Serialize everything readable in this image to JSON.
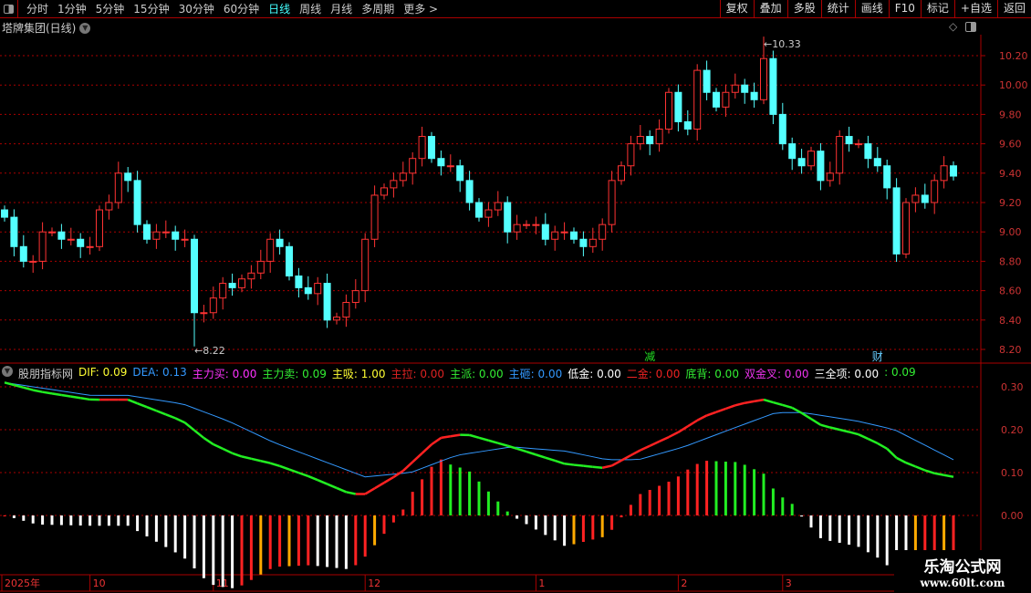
{
  "toolbar": {
    "periods": [
      "分时",
      "1分钟",
      "5分钟",
      "15分钟",
      "30分钟",
      "60分钟",
      "日线",
      "周线",
      "月线",
      "多周期",
      "更多 >"
    ],
    "active_period": "日线",
    "right_buttons": [
      "复权",
      "叠加",
      "多股",
      "统计",
      "画线",
      "F10",
      "标记",
      "+自选",
      "返回"
    ]
  },
  "main": {
    "title": "塔牌集团(日线)",
    "high_label": "10.33",
    "low_label": "8.22",
    "markers": [
      {
        "text": "减",
        "index": 68,
        "color": "#22dd22"
      },
      {
        "text": "财",
        "index": 92,
        "color": "#66ccff"
      }
    ],
    "yticks": [
      "10.20",
      "10.00",
      "9.80",
      "9.60",
      "9.40",
      "9.20",
      "9.00",
      "8.80",
      "8.60",
      "8.40",
      "8.20"
    ]
  },
  "indicator": {
    "name": "股朋指标网",
    "items": [
      {
        "label": "DIF",
        "value": "0.09",
        "color": "#ffff33"
      },
      {
        "label": "DEA",
        "value": "0.13",
        "color": "#3399ff"
      },
      {
        "label": "主力买",
        "value": "0.00",
        "color": "#ff33ff"
      },
      {
        "label": "主力卖",
        "value": "0.09",
        "color": "#33ee33"
      },
      {
        "label": "主吸",
        "value": "1.00",
        "color": "#ffff33"
      },
      {
        "label": "主拉",
        "value": "0.00",
        "color": "#dd2222"
      },
      {
        "label": "主派",
        "value": "0.00",
        "color": "#33ee33"
      },
      {
        "label": "主砸",
        "value": "0.00",
        "color": "#3399ff"
      },
      {
        "label": "低金",
        "value": "0.00",
        "color": "#ffffff"
      },
      {
        "label": "二金",
        "value": "0.00",
        "color": "#ee2222"
      },
      {
        "label": "底背",
        "value": "0.00",
        "color": "#33ee33"
      },
      {
        "label": "双金叉",
        "value": "0.00",
        "color": "#ee33ee"
      },
      {
        "label": "三全项",
        "value": "0.00",
        "color": "#ffffff"
      },
      {
        "label": "",
        "value": "0.09",
        "color": "#33ee33"
      }
    ],
    "yticks": [
      "0.30",
      "0.20",
      "0.10",
      "0.00"
    ]
  },
  "time_axis": [
    {
      "label": "2025年",
      "index": 0
    },
    {
      "label": "10",
      "index": 9
    },
    {
      "label": "11",
      "index": 22
    },
    {
      "label": "12",
      "index": 38
    },
    {
      "label": "1",
      "index": 56
    },
    {
      "label": "2",
      "index": 71
    },
    {
      "label": "3",
      "index": 82
    }
  ],
  "watermark": {
    "line1": "乐淘公式网",
    "line2": "www.60lt.com"
  },
  "chart_data": {
    "type": "candlestick",
    "ylim": [
      8.1,
      10.4
    ],
    "start_open": 9.15,
    "closes": [
      9.1,
      8.9,
      8.8,
      8.8,
      9.0,
      9.0,
      8.95,
      8.95,
      8.9,
      8.9,
      9.15,
      9.2,
      9.4,
      9.35,
      9.05,
      8.95,
      9.0,
      9.0,
      8.95,
      8.95,
      8.45,
      8.45,
      8.55,
      8.65,
      8.62,
      8.68,
      8.72,
      8.8,
      8.95,
      8.9,
      8.7,
      8.62,
      8.58,
      8.65,
      8.4,
      8.42,
      8.52,
      8.6,
      8.95,
      9.25,
      9.3,
      9.35,
      9.4,
      9.5,
      9.65,
      9.5,
      9.45,
      9.45,
      9.35,
      9.2,
      9.1,
      9.15,
      9.2,
      9.0,
      9.05,
      9.05,
      9.05,
      8.95,
      9.0,
      9.0,
      8.95,
      8.9,
      8.95,
      9.05,
      9.35,
      9.45,
      9.6,
      9.65,
      9.6,
      9.7,
      9.95,
      9.75,
      9.7,
      10.1,
      9.95,
      9.85,
      9.95,
      10.0,
      9.95,
      9.9,
      10.18,
      9.8,
      9.6,
      9.5,
      9.45,
      9.55,
      9.35,
      9.4,
      9.65,
      9.6,
      9.6,
      9.5,
      9.45,
      9.3,
      8.85,
      9.2,
      9.25,
      9.2,
      9.35,
      9.45,
      9.38
    ],
    "high": {
      "index": 80,
      "value": 10.33
    },
    "low": {
      "index": 20,
      "value": 8.22
    },
    "macd": {
      "ylim": [
        -0.15,
        0.33
      ],
      "dif": [
        [
          0,
          0.31
        ],
        [
          3.4,
          0.29
        ],
        [
          9.1,
          0.27
        ],
        [
          13,
          0.27
        ],
        [
          18.8,
          0.22
        ],
        [
          21.6,
          0.17
        ],
        [
          24.5,
          0.14
        ],
        [
          28.4,
          0.12
        ],
        [
          32.2,
          0.09
        ],
        [
          36.5,
          0.05
        ],
        [
          38,
          0.05
        ],
        [
          41.8,
          0.1
        ],
        [
          45.7,
          0.18
        ],
        [
          48.6,
          0.19
        ],
        [
          53.4,
          0.16
        ],
        [
          59.1,
          0.12
        ],
        [
          63.5,
          0.11
        ],
        [
          66.8,
          0.15
        ],
        [
          70.7,
          0.19
        ],
        [
          73.6,
          0.23
        ],
        [
          77.4,
          0.26
        ],
        [
          80,
          0.27
        ],
        [
          83.2,
          0.25
        ],
        [
          86.1,
          0.21
        ],
        [
          89.9,
          0.19
        ],
        [
          92.8,
          0.16
        ],
        [
          94.2,
          0.13
        ],
        [
          97.6,
          0.1
        ],
        [
          100,
          0.09
        ]
      ],
      "dea": [
        [
          0,
          0.31
        ],
        [
          9.1,
          0.28
        ],
        [
          13,
          0.28
        ],
        [
          18.8,
          0.26
        ],
        [
          23.6,
          0.22
        ],
        [
          28.4,
          0.17
        ],
        [
          33.2,
          0.13
        ],
        [
          38,
          0.09
        ],
        [
          42.8,
          0.1
        ],
        [
          47.6,
          0.14
        ],
        [
          53.4,
          0.16
        ],
        [
          59.1,
          0.15
        ],
        [
          63.5,
          0.13
        ],
        [
          66.8,
          0.13
        ],
        [
          71.6,
          0.16
        ],
        [
          76.4,
          0.2
        ],
        [
          81.3,
          0.24
        ],
        [
          84.1,
          0.24
        ],
        [
          89.9,
          0.22
        ],
        [
          93.8,
          0.2
        ],
        [
          100,
          0.13
        ]
      ]
    }
  }
}
